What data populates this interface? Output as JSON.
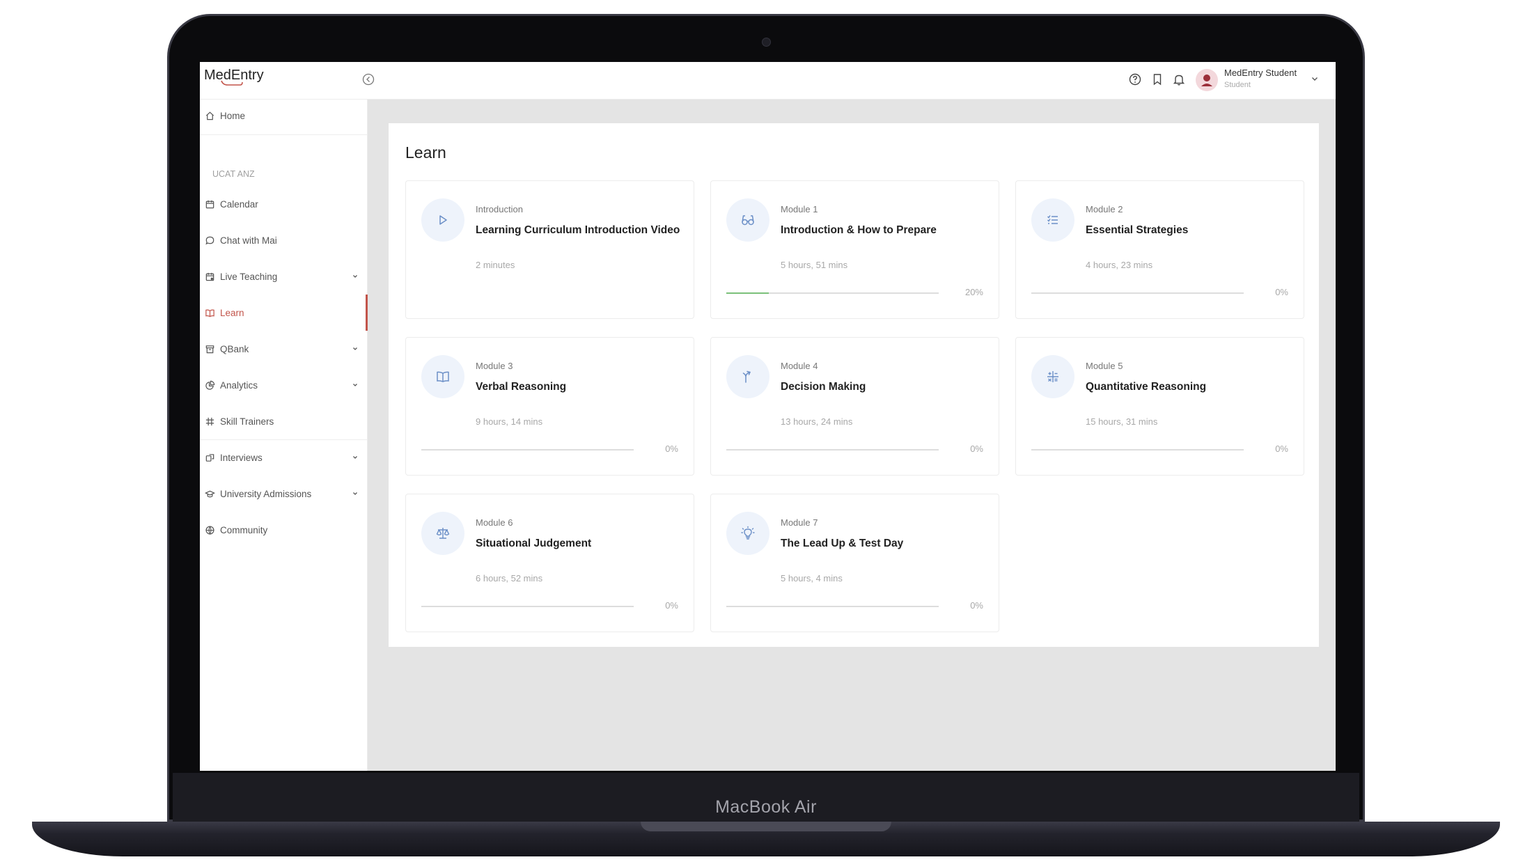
{
  "device": {
    "brand_text": "MacBook Air"
  },
  "app": {
    "logo_text": "MedEntry"
  },
  "header": {
    "user_name": "MedEntry Student",
    "user_role": "Student",
    "icons": [
      "help-circle-icon",
      "bookmark-icon",
      "bell-icon"
    ]
  },
  "sidebar": {
    "section_label": "UCAT ANZ",
    "items": [
      {
        "label": "Home",
        "icon": "home-icon"
      },
      {
        "label": "Calendar",
        "icon": "calendar-icon"
      },
      {
        "label": "Chat with Mai",
        "icon": "chat-icon"
      },
      {
        "label": "Live Teaching",
        "icon": "live-calendar-icon",
        "has_submenu": true
      },
      {
        "label": "Learn",
        "icon": "book-open-icon",
        "active": true
      },
      {
        "label": "QBank",
        "icon": "archive-icon",
        "has_submenu": true
      },
      {
        "label": "Analytics",
        "icon": "pie-chart-icon",
        "has_submenu": true
      },
      {
        "label": "Skill Trainers",
        "icon": "grid-hash-icon"
      },
      {
        "label": "Interviews",
        "icon": "interview-icon",
        "has_submenu": true
      },
      {
        "label": "University Admissions",
        "icon": "graduation-cap-icon",
        "has_submenu": true
      },
      {
        "label": "Community",
        "icon": "globe-icon"
      }
    ]
  },
  "main": {
    "title": "Learn",
    "modules": [
      {
        "label": "Introduction",
        "title": "Learning Curriculum Introduction Video",
        "duration": "2 minutes",
        "progress": null,
        "progress_text": "",
        "icon": "play-icon"
      },
      {
        "label": "Module 1",
        "title": "Introduction & How to Prepare",
        "duration": "5 hours, 51 mins",
        "progress": 20,
        "progress_text": "20%",
        "icon": "glasses-icon"
      },
      {
        "label": "Module 2",
        "title": "Essential Strategies",
        "duration": "4 hours, 23 mins",
        "progress": 0,
        "progress_text": "0%",
        "icon": "list-icon"
      },
      {
        "label": "Module 3",
        "title": "Verbal Reasoning",
        "duration": "9 hours, 14 mins",
        "progress": 0,
        "progress_text": "0%",
        "icon": "book-icon"
      },
      {
        "label": "Module 4",
        "title": "Decision Making",
        "duration": "13 hours, 24 mins",
        "progress": 0,
        "progress_text": "0%",
        "icon": "split-arrow-icon"
      },
      {
        "label": "Module 5",
        "title": "Quantitative Reasoning",
        "duration": "15 hours, 31 mins",
        "progress": 0,
        "progress_text": "0%",
        "icon": "calculator-icon"
      },
      {
        "label": "Module 6",
        "title": "Situational Judgement",
        "duration": "6 hours, 52 mins",
        "progress": 0,
        "progress_text": "0%",
        "icon": "scales-icon"
      },
      {
        "label": "Module 7",
        "title": "The Lead Up & Test Day",
        "duration": "5 hours, 4 mins",
        "progress": 0,
        "progress_text": "0%",
        "icon": "lightbulb-icon"
      }
    ]
  },
  "colors": {
    "accent": "#c2544a",
    "progress": "#7bc07a",
    "icon_blue": "#6b8fc7",
    "icon_bg": "#eef3fb"
  }
}
